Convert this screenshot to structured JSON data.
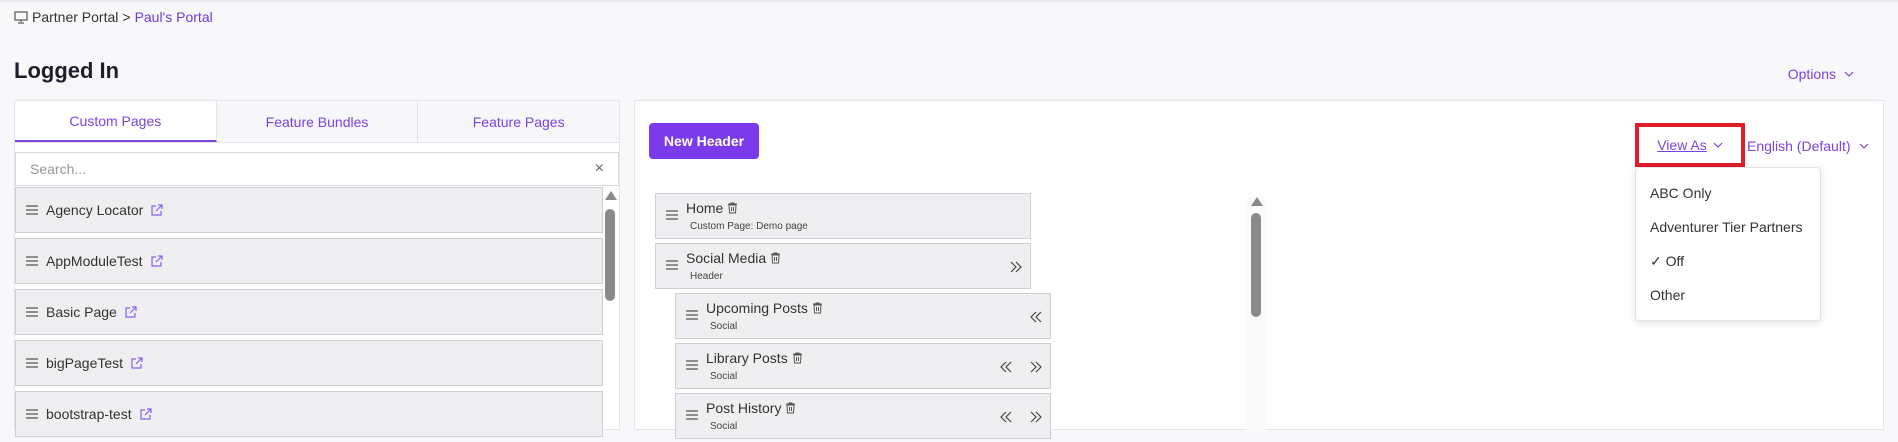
{
  "breadcrumb": {
    "root": "Partner Portal",
    "separator": ">",
    "current": "Paul's Portal"
  },
  "page_title": "Logged In",
  "options_label": "Options",
  "tabs": [
    {
      "label": "Custom Pages"
    },
    {
      "label": "Feature Bundles"
    },
    {
      "label": "Feature Pages"
    }
  ],
  "search": {
    "placeholder": "Search...",
    "clear": "×"
  },
  "pages": [
    {
      "label": "Agency Locator"
    },
    {
      "label": "AppModuleTest"
    },
    {
      "label": "Basic Page"
    },
    {
      "label": "bigPageTest"
    },
    {
      "label": "bootstrap-test"
    }
  ],
  "toolbar": {
    "new_header": "New Header",
    "view_as": "View As",
    "language": "English (Default)"
  },
  "view_as_menu": [
    {
      "label": "ABC Only"
    },
    {
      "label": "Adventurer Tier Partners"
    },
    {
      "label": "✓ Off"
    },
    {
      "label": "Other"
    }
  ],
  "tree": [
    {
      "name": "Home",
      "sub": "Custom Page: Demo page"
    },
    {
      "name": "Social Media",
      "sub": "Header"
    },
    {
      "name": "Upcoming Posts",
      "sub": "Social"
    },
    {
      "name": "Library Posts",
      "sub": "Social"
    },
    {
      "name": "Post History",
      "sub": "Social"
    }
  ],
  "colors": {
    "accent": "#7c3aed",
    "highlight": "#e11d2a"
  }
}
